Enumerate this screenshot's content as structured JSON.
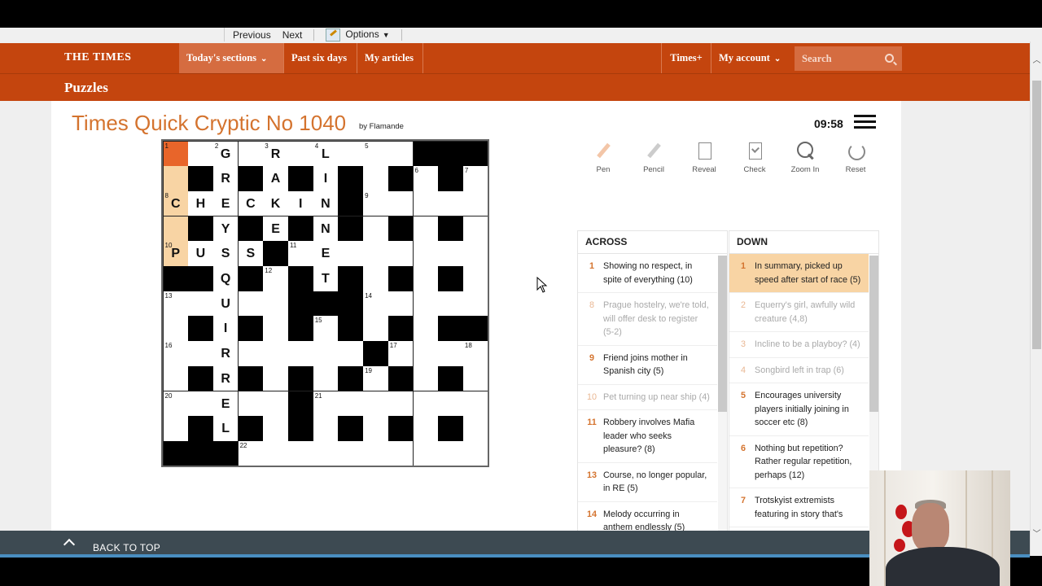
{
  "browser_toolbar": {
    "previous_label": "Previous",
    "next_label": "Next",
    "options_label": "Options"
  },
  "nav": {
    "logo": "THE TIMES",
    "today_sections": "Today's sections",
    "past_six_days": "Past six days",
    "my_articles": "My articles",
    "times_plus": "Times+",
    "my_account": "My account",
    "search_placeholder": "Search",
    "accent_color": "#c4450e"
  },
  "subbar": {
    "title": "Puzzles"
  },
  "puzzle": {
    "title": "Times Quick Cryptic No 1040",
    "author": "by Flamande",
    "timer": "09:58"
  },
  "grid": {
    "size": 13,
    "rows": [
      "#.#.#.#.#.XXX",
      "#X#X#X#X#X#X#",
      "#.#.#.#X#.#.#",
      "#X#X#X#X#X#X#",
      "#.#.X.#.#.#.#",
      "XX#X#X#X#X#X#",
      "#.#.#XXX#.#.#",
      "#X#X#X#X#X#XX",
      "#.#.#.#.X.#.#",
      "#X#X#X#X#X#X#",
      "#.#.#X#.#.#.#",
      "#X#X#X#X#X#X#",
      "XXX.#.#.#.#.#"
    ],
    "numbers": [
      {
        "r": 0,
        "c": 0,
        "n": "1"
      },
      {
        "r": 0,
        "c": 2,
        "n": "2"
      },
      {
        "r": 0,
        "c": 4,
        "n": "3"
      },
      {
        "r": 0,
        "c": 6,
        "n": "4"
      },
      {
        "r": 0,
        "c": 8,
        "n": "5"
      },
      {
        "r": 1,
        "c": 10,
        "n": "6"
      },
      {
        "r": 1,
        "c": 12,
        "n": "7"
      },
      {
        "r": 2,
        "c": 0,
        "n": "8"
      },
      {
        "r": 2,
        "c": 8,
        "n": "9"
      },
      {
        "r": 4,
        "c": 0,
        "n": "10"
      },
      {
        "r": 4,
        "c": 5,
        "n": "11"
      },
      {
        "r": 5,
        "c": 4,
        "n": "12"
      },
      {
        "r": 6,
        "c": 0,
        "n": "13"
      },
      {
        "r": 6,
        "c": 8,
        "n": "14"
      },
      {
        "r": 7,
        "c": 6,
        "n": "15"
      },
      {
        "r": 8,
        "c": 0,
        "n": "16"
      },
      {
        "r": 8,
        "c": 9,
        "n": "17"
      },
      {
        "r": 8,
        "c": 12,
        "n": "18"
      },
      {
        "r": 9,
        "c": 8,
        "n": "19"
      },
      {
        "r": 10,
        "c": 0,
        "n": "20"
      },
      {
        "r": 10,
        "c": 6,
        "n": "21"
      },
      {
        "r": 12,
        "c": 3,
        "n": "22"
      }
    ],
    "letters": [
      {
        "r": 0,
        "c": 2,
        "l": "G"
      },
      {
        "r": 0,
        "c": 4,
        "l": "R"
      },
      {
        "r": 0,
        "c": 6,
        "l": "L"
      },
      {
        "r": 1,
        "c": 2,
        "l": "R"
      },
      {
        "r": 1,
        "c": 4,
        "l": "A"
      },
      {
        "r": 1,
        "c": 6,
        "l": "I"
      },
      {
        "r": 2,
        "c": 0,
        "l": "C"
      },
      {
        "r": 2,
        "c": 1,
        "l": "H"
      },
      {
        "r": 2,
        "c": 2,
        "l": "E"
      },
      {
        "r": 2,
        "c": 3,
        "l": "C"
      },
      {
        "r": 2,
        "c": 4,
        "l": "K"
      },
      {
        "r": 2,
        "c": 5,
        "l": "I"
      },
      {
        "r": 2,
        "c": 6,
        "l": "N"
      },
      {
        "r": 3,
        "c": 2,
        "l": "Y"
      },
      {
        "r": 3,
        "c": 4,
        "l": "E"
      },
      {
        "r": 3,
        "c": 6,
        "l": "N"
      },
      {
        "r": 4,
        "c": 0,
        "l": "P"
      },
      {
        "r": 4,
        "c": 1,
        "l": "U"
      },
      {
        "r": 4,
        "c": 2,
        "l": "S"
      },
      {
        "r": 4,
        "c": 3,
        "l": "S"
      },
      {
        "r": 4,
        "c": 6,
        "l": "E"
      },
      {
        "r": 5,
        "c": 2,
        "l": "Q"
      },
      {
        "r": 5,
        "c": 6,
        "l": "T"
      },
      {
        "r": 6,
        "c": 2,
        "l": "U"
      },
      {
        "r": 7,
        "c": 2,
        "l": "I"
      },
      {
        "r": 8,
        "c": 2,
        "l": "R"
      },
      {
        "r": 9,
        "c": 2,
        "l": "R"
      },
      {
        "r": 10,
        "c": 2,
        "l": "E"
      },
      {
        "r": 11,
        "c": 2,
        "l": "L"
      }
    ],
    "highlighted": [
      {
        "r": 0,
        "c": 0
      },
      {
        "r": 1,
        "c": 0
      },
      {
        "r": 2,
        "c": 0
      },
      {
        "r": 3,
        "c": 0
      },
      {
        "r": 4,
        "c": 0
      }
    ],
    "current": {
      "r": 0,
      "c": 0
    },
    "highlight_color": "#f8d4a4",
    "current_color": "#e8652a"
  },
  "tools": [
    {
      "label": "Pen",
      "icon": "pen-icon"
    },
    {
      "label": "Pencil",
      "icon": "pencil-icon"
    },
    {
      "label": "Reveal",
      "icon": "reveal-icon"
    },
    {
      "label": "Check",
      "icon": "check-icon"
    },
    {
      "label": "Zoom In",
      "icon": "zoom-in-icon"
    },
    {
      "label": "Reset",
      "icon": "reset-icon"
    }
  ],
  "across": {
    "heading": "ACROSS",
    "clues": [
      {
        "n": "1",
        "text": "Showing no respect, in spite of everything (10)",
        "done": false
      },
      {
        "n": "8",
        "text": "Prague hostelry, we're told, will offer desk to register (5-2)",
        "done": true
      },
      {
        "n": "9",
        "text": "Friend joins mother in Spanish city (5)",
        "done": false
      },
      {
        "n": "10",
        "text": "Pet turning up near ship (4)",
        "done": true
      },
      {
        "n": "11",
        "text": "Robbery involves Mafia leader who seeks pleasure? (8)",
        "done": false
      },
      {
        "n": "13",
        "text": "Course, no longer popular, in RE (5)",
        "done": false
      },
      {
        "n": "14",
        "text": "Melody occurring in anthem endlessly (5)",
        "done": false
      }
    ]
  },
  "down": {
    "heading": "DOWN",
    "clues": [
      {
        "n": "1",
        "text": "In summary, picked up speed after start of race (5)",
        "done": false,
        "active": true
      },
      {
        "n": "2",
        "text": "Equerry's girl, awfully wild creature (4,8)",
        "done": true
      },
      {
        "n": "3",
        "text": "Incline to be a playboy? (4)",
        "done": true
      },
      {
        "n": "4",
        "text": "Songbird left in trap (6)",
        "done": true
      },
      {
        "n": "5",
        "text": "Encourages university players initially joining in soccer etc (8)",
        "done": false
      },
      {
        "n": "6",
        "text": "Nothing but repetition? Rather regular repetition, perhaps (12)",
        "done": false
      },
      {
        "n": "7",
        "text": "Trotskyist extremists featuring in story that's",
        "done": false
      }
    ]
  },
  "footer": {
    "back_to_top": "BACK TO TOP"
  }
}
